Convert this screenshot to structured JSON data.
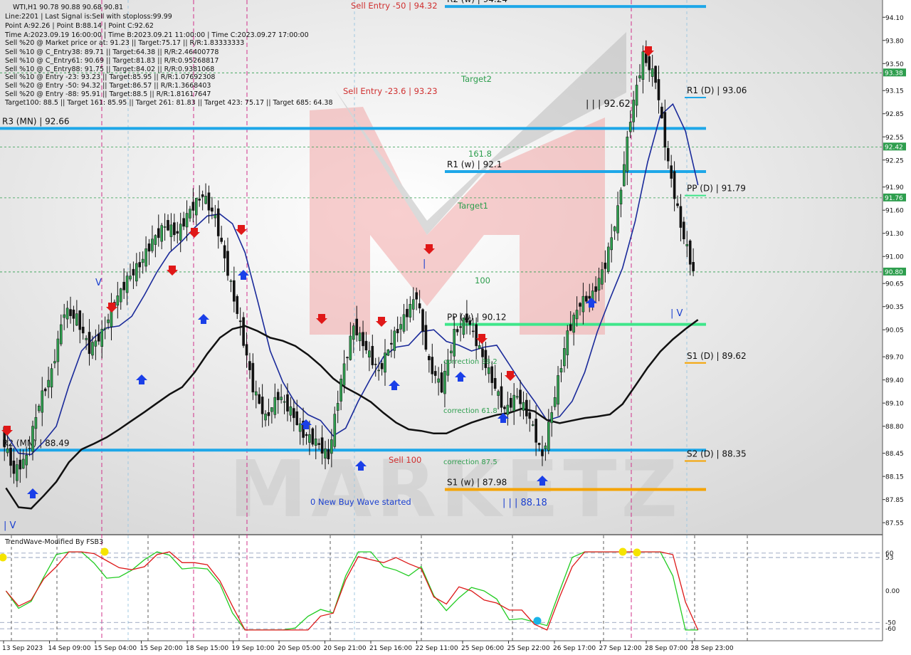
{
  "info_panel": {
    "lines": [
      "WTI,H1  90.78 90.88 90.68 90.81",
      "Line:2201 | Last Signal is:Sell with stoploss:99.99",
      "Point A:92.26 | Point B:88.14 | Point C:92.62",
      "Time A:2023.09.19 16:00:00 | Time B:2023.09.21 11:00:00 | Time C:2023.09.27 17:00:00",
      "Sell %20 @ Market price or at: 91.23 || Target:75.17 || R/R:1.83333333",
      "Sell %10 @ C_Entry38: 89.71 || Target:64.38 || R/R:2.46400778",
      "Sell %10 @ C_Entry61: 90.69 || Target:81.83 || R/R:0.95268817",
      "Sell %10 @ C_Entry88: 91.75 || Target:84.02 || R/R:0.9381068",
      "Sell %10 @ Entry -23: 93.23 || Target:85.95 || R/R:1.07692308",
      "Sell %20 @ Entry -50: 94.32 || Target:86.57 || R/R:1.3668403",
      "Sell %20 @ Entry -88: 95.91 || Target:88.5 || R/R:1.81617647",
      "Target100: 88.5 || Target 161: 85.95 || Target 261: 81.83 || Target 423: 75.17 || Target 685: 64.38"
    ]
  },
  "price_axis": {
    "ticks": [
      "94.10",
      "93.80",
      "93.50",
      "93.15",
      "92.85",
      "92.55",
      "92.25",
      "91.90",
      "91.60",
      "91.30",
      "91.00",
      "90.65",
      "90.35",
      "90.05",
      "89.70",
      "89.40",
      "89.10",
      "88.80",
      "88.45",
      "88.15",
      "87.85",
      "87.55"
    ],
    "badges": [
      {
        "text": "93.38",
        "color": "#2e9e4e"
      },
      {
        "text": "92.42",
        "color": "#2e9e4e"
      },
      {
        "text": "91.76",
        "color": "#2e9e4e"
      },
      {
        "text": "90.80",
        "color": "#2e9e4e"
      }
    ]
  },
  "time_axis": {
    "labels": [
      "13 Sep 2023",
      "14 Sep 09:00",
      "15 Sep 04:00",
      "15 Sep 20:00",
      "18 Sep 15:00",
      "19 Sep 10:00",
      "20 Sep 05:00",
      "20 Sep 21:00",
      "21 Sep 16:00",
      "22 Sep 11:00",
      "25 Sep 06:00",
      "25 Sep 22:00",
      "26 Sep 17:00",
      "27 Sep 12:00",
      "28 Sep 07:00",
      "28 Sep 23:00"
    ]
  },
  "levels": [
    {
      "label": "R2 (w) | 94.24",
      "price": 94.24,
      "color": "#1ea7e8"
    },
    {
      "label": "R3 (MN) | 92.66",
      "price": 92.66,
      "color": "#1ea7e8"
    },
    {
      "label": "R1 (w) | 92.1",
      "price": 92.1,
      "color": "#1ea7e8"
    },
    {
      "label": "PP (w) | 90.12",
      "price": 90.12,
      "color": "#3ee68a"
    },
    {
      "label": "R2 (MN) | 88.49",
      "price": 88.49,
      "color": "#1ea7e8"
    },
    {
      "label": "S1 (w) | 87.98",
      "price": 87.98,
      "color": "#f5a300"
    },
    {
      "label": "R1 (D) | 93.06",
      "price": 93.06,
      "color": "#1ea7e8"
    },
    {
      "label": "PP (D) | 91.79",
      "price": 91.79,
      "color": "#3ee68a"
    },
    {
      "label": "S1 (D) | 89.62",
      "price": 89.62,
      "color": "#f5a300"
    },
    {
      "label": "S2 (D) | 88.35",
      "price": 88.35,
      "color": "#f5a300"
    }
  ],
  "annotations": {
    "sell_entry_50": "Sell Entry -50 | 94.32",
    "sell_entry_236": "Sell Entry -23.6 | 93.23",
    "target2": "Target2",
    "level_1618": "161.8",
    "target1": "Target1",
    "level_100": "100",
    "sell_100": "Sell 100",
    "correction_382": "correction 38.2",
    "correction_618": "correction 61.8",
    "correction_875": "correction 87.5",
    "new_buy_wave": "0 New Buy Wave started",
    "point_c": "| | | 92.62",
    "point_b": "| | | 88.18",
    "wave_iv": "| V",
    "wave_v": "V",
    "wave_i": "|",
    "wave_iv_left": "| V"
  },
  "oscillator": {
    "title": "TrendWave-Modified By FSB3",
    "ticks": [
      "60",
      "53",
      "0.00",
      "-50",
      "-60"
    ]
  },
  "chart_data": {
    "type": "line",
    "title": "WTI,H1",
    "ylim": [
      87.45,
      94.25
    ],
    "series": [
      {
        "name": "close",
        "values": [
          88.7,
          88.2,
          88.4,
          89.1,
          89.5,
          90.3,
          90.2,
          89.8,
          90.0,
          90.4,
          90.7,
          90.9,
          91.2,
          91.4,
          91.3,
          91.6,
          91.8,
          91.5,
          90.8,
          90.1,
          89.3,
          88.9,
          89.2,
          89.0,
          88.7,
          88.6,
          88.4,
          89.4,
          90.1,
          89.8,
          89.5,
          89.9,
          90.2,
          90.5,
          89.6,
          89.3,
          90.0,
          90.2,
          89.8,
          89.4,
          89.0,
          89.2,
          88.9,
          88.4,
          89.2,
          90.0,
          90.4,
          90.5,
          90.9,
          91.6,
          92.8,
          93.6,
          93.3,
          92.2,
          91.4,
          90.8
        ]
      }
    ]
  }
}
